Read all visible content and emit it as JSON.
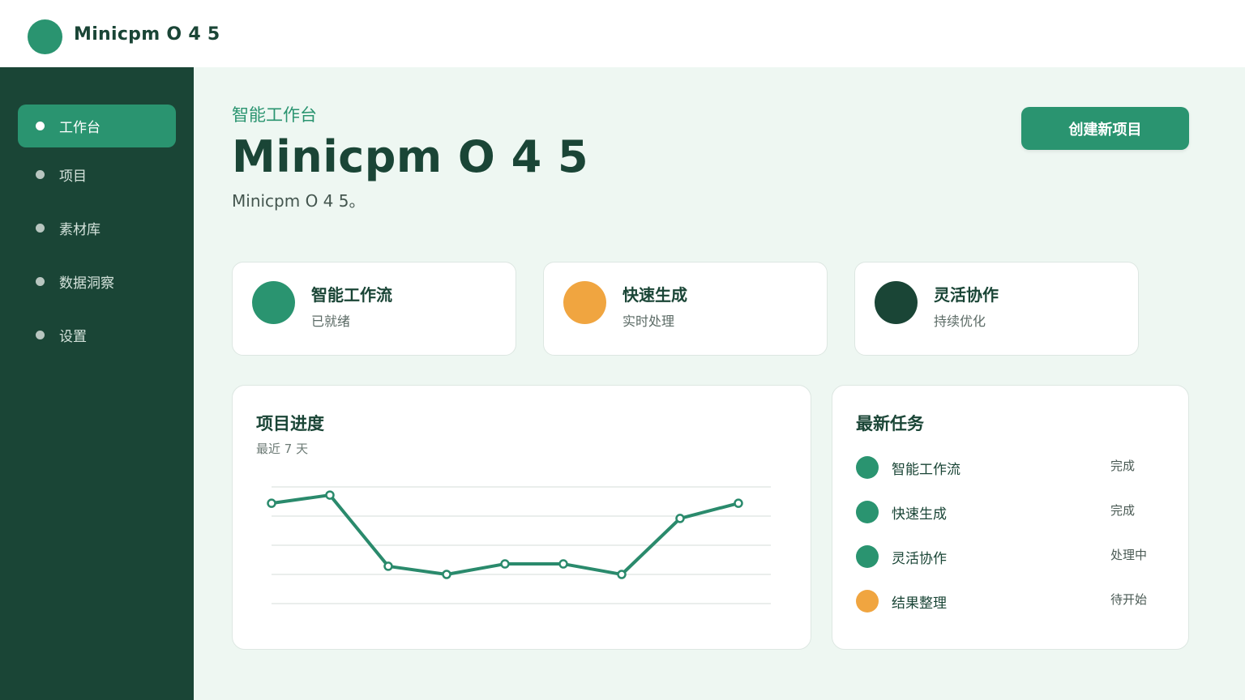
{
  "header": {
    "app_title": "Minicpm O 4 5"
  },
  "sidebar": {
    "items": [
      {
        "label": "工作台",
        "active": true
      },
      {
        "label": "项目",
        "active": false
      },
      {
        "label": "素材库",
        "active": false
      },
      {
        "label": "数据洞察",
        "active": false
      },
      {
        "label": "设置",
        "active": false
      }
    ]
  },
  "main": {
    "kicker": "智能工作台",
    "title": "Minicpm O 4 5",
    "description": "Minicpm O 4 5。",
    "create_button": "创建新项目"
  },
  "features": [
    {
      "title": "智能工作流",
      "subtitle": "已就绪",
      "color": "#2a9470"
    },
    {
      "title": "快速生成",
      "subtitle": "实时处理",
      "color": "#f0a540"
    },
    {
      "title": "灵活协作",
      "subtitle": "持续优化",
      "color": "#1a4536"
    }
  ],
  "progress_panel": {
    "title": "项目进度",
    "subtitle": "最近 7 天"
  },
  "chart_data": {
    "type": "line",
    "x": [
      1,
      2,
      3,
      4,
      5,
      6,
      7,
      8,
      9
    ],
    "series": [
      {
        "values": [
          86,
          93,
          32,
          25,
          34,
          34,
          25,
          73,
          86
        ],
        "color": "#2a8a6c"
      }
    ],
    "ylim": [
      0,
      100
    ],
    "grid": true,
    "legend": "none"
  },
  "tasks_panel": {
    "title": "最新任务",
    "tasks": [
      {
        "name": "智能工作流",
        "status": "完成",
        "color": "#2a9470"
      },
      {
        "name": "快速生成",
        "status": "完成",
        "color": "#2a9470"
      },
      {
        "name": "灵活协作",
        "status": "处理中",
        "color": "#2a9470"
      },
      {
        "name": "结果整理",
        "status": "待开始",
        "color": "#f0a540"
      }
    ]
  },
  "colors": {
    "brand": "#2a9470",
    "dark": "#1a4536",
    "accent": "#f0a540",
    "background": "#eef7f2"
  }
}
